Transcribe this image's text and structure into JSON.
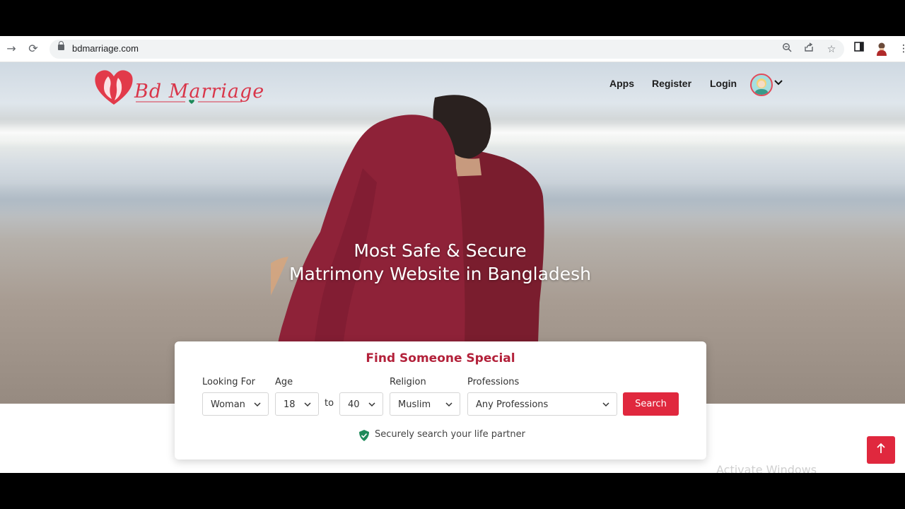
{
  "browser": {
    "url": "bdmarriage.com"
  },
  "header": {
    "logo_text": "Bd Marriage",
    "nav": [
      "Apps",
      "Register",
      "Login"
    ]
  },
  "hero": {
    "headline_line1": "Most Safe & Secure",
    "headline_line2": "Matrimony Website in Bangladesh"
  },
  "search_card": {
    "title": "Find Someone Special",
    "looking_for": {
      "label": "Looking For",
      "value": "Woman"
    },
    "age": {
      "label": "Age",
      "min": "18",
      "separator": "to",
      "max": "40"
    },
    "religion": {
      "label": "Religion",
      "value": "Muslim"
    },
    "professions": {
      "label": "Professions",
      "value": "Any Professions"
    },
    "button": "Search",
    "secure_note": "Securely search your life partner"
  },
  "overlay": {
    "watermark": "Activate Windows"
  },
  "colors": {
    "accent": "#e0283e",
    "title": "#b3213a",
    "shield": "#1e8a5a"
  }
}
